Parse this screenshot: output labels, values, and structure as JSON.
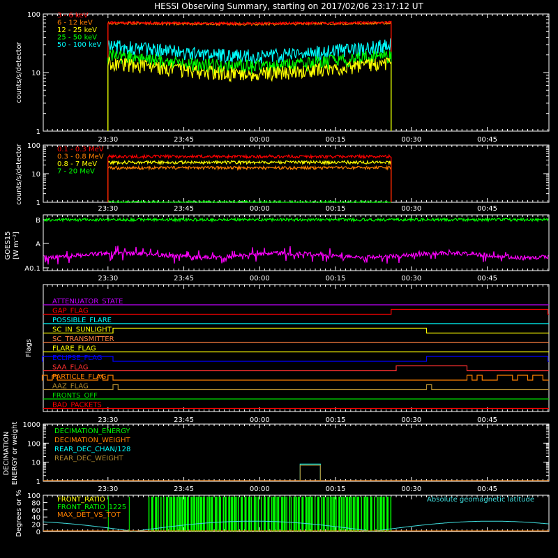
{
  "title": "HESSI Observing Summary, starting on 2017/02/06 23:17:12 UT",
  "time_axis": {
    "start": "23:17:12",
    "end": "00:57:12",
    "tick_labels": [
      "23:30",
      "23:45",
      "00:00",
      "00:15",
      "00:30",
      "00:45"
    ]
  },
  "chart_data": [
    {
      "type": "line",
      "id": "low_energy",
      "ylabel": "counts/s/detector",
      "yscale": "log",
      "ylim": [
        1,
        100
      ],
      "ytick_labels": [
        "1",
        "10",
        "100"
      ],
      "data_interval": [
        "23:30",
        "00:26"
      ],
      "series": [
        {
          "name": "3 - 6 keV",
          "color": "#ff0000",
          "level": 72
        },
        {
          "name": "6 - 12 keV",
          "color": "#ff7f00",
          "level": 70
        },
        {
          "name": "12 - 25 keV",
          "color": "#ffff00",
          "level": 15
        },
        {
          "name": "25 - 50 keV",
          "color": "#00ff00",
          "level": 20
        },
        {
          "name": "50 - 100 keV",
          "color": "#00ffff",
          "level": 30
        }
      ]
    },
    {
      "type": "line",
      "id": "high_energy",
      "ylabel": "counts/s/detector",
      "yscale": "log",
      "ylim": [
        1,
        100
      ],
      "ytick_labels": [
        "1",
        "10",
        "100"
      ],
      "data_interval": [
        "23:30",
        "00:26"
      ],
      "series": [
        {
          "name": "0.1 - 0.3 MeV",
          "color": "#ff0000",
          "level": 40
        },
        {
          "name": "0.3 - 0.8 MeV",
          "color": "#ff7f00",
          "level": 16
        },
        {
          "name": "0.8 - 7 MeV",
          "color": "#ffff00",
          "level": 25
        },
        {
          "name": "7 - 20 MeV",
          "color": "#00ff00",
          "level": 1
        }
      ]
    },
    {
      "type": "line",
      "id": "goes",
      "ylabel": "GOES15",
      "ylabel2": "[W m⁻²]",
      "ytick_labels": [
        "A0.1",
        "A",
        "B"
      ],
      "series": [
        {
          "name": "long",
          "color": "#00ff00",
          "level": "B"
        },
        {
          "name": "short",
          "color": "#ff00ff",
          "level": "A0.3"
        }
      ]
    },
    {
      "type": "line",
      "id": "flags",
      "ylabel": "Flags",
      "flags": [
        {
          "name": "ATTENUATOR_STATE",
          "color": "#c000ff",
          "segments": []
        },
        {
          "name": "GAP_FLAG",
          "color": "#ff0000",
          "segments": [
            [
              "00:26",
              "00:57"
            ]
          ]
        },
        {
          "name": "POSSIBLE_FLARE",
          "color": "#00ffff",
          "segments": []
        },
        {
          "name": "SC_IN_SUNLIGHT",
          "color": "#ffff00",
          "segments": [
            [
              "23:31",
              "00:33"
            ]
          ]
        },
        {
          "name": "SC_TRANSMITTER",
          "color": "#ff8040",
          "segments": []
        },
        {
          "name": "FLARE_FLAG",
          "color": "#ffff00",
          "segments": []
        },
        {
          "name": "ECLIPSE_FLAG",
          "color": "#0000ff",
          "segments": [
            [
              "23:17",
              "23:31"
            ],
            [
              "00:33",
              "00:57"
            ]
          ]
        },
        {
          "name": "SAA_FLAG",
          "color": "#ff3030",
          "segments": [
            [
              "00:27",
              "00:41"
            ]
          ]
        },
        {
          "name": "PARTICLE_FLAG",
          "color": "#ff8000",
          "segments": [
            [
              "23:17",
              "23:18"
            ],
            [
              "23:19",
              "23:20"
            ],
            [
              "23:28",
              "23:29"
            ],
            [
              "23:30",
              "23:31"
            ],
            [
              "00:41",
              "00:42"
            ],
            [
              "00:43",
              "00:44"
            ],
            [
              "00:47",
              "00:50"
            ],
            [
              "00:51",
              "00:53"
            ],
            [
              "00:54",
              "00:56"
            ]
          ]
        },
        {
          "name": "AAZ_FLAG",
          "color": "#b08a30",
          "segments": [
            [
              "23:31",
              "23:32"
            ],
            [
              "00:33",
              "00:34"
            ]
          ]
        },
        {
          "name": "FRONTS_OFF",
          "color": "#00e000",
          "segments": []
        },
        {
          "name": "BAD_PACKETS",
          "color": "#ff0000",
          "segments": []
        }
      ]
    },
    {
      "type": "line",
      "id": "decimation",
      "ylabel": "DECIMATION",
      "ylabel2": "ENERGY or weight",
      "yscale": "log",
      "ylim": [
        1,
        1000
      ],
      "ytick_labels": [
        "1",
        "10",
        "100",
        "1000"
      ],
      "series": [
        {
          "name": "DECIMATION_ENERGY",
          "color": "#00ff00"
        },
        {
          "name": "DECIMATION_WEIGHT",
          "color": "#ff8000"
        },
        {
          "name": "REAR_DEC_CHAN/128",
          "color": "#00ffff",
          "interval": [
            "00:08",
            "00:12"
          ],
          "level": 8
        },
        {
          "name": "REAR_DEC_WEIGHT",
          "color": "#b08a30",
          "interval": [
            "00:08",
            "00:12"
          ],
          "level": 7
        }
      ]
    },
    {
      "type": "line",
      "id": "ratio",
      "ylabel": "Degrees or %",
      "ylim": [
        0,
        100
      ],
      "ytick_labels": [
        "0",
        "20",
        "40",
        "60",
        "80",
        "100"
      ],
      "annotation": "Absolute geomagnetic latitude",
      "series": [
        {
          "name": "FRONT_RATIO",
          "color": "#ffff00"
        },
        {
          "name": "FRONT_RATIO_1225",
          "color": "#00ff00"
        },
        {
          "name": "MAX_DET_VS_TOT",
          "color": "#ff8000"
        },
        {
          "name": "Absolute geomagnetic latitude",
          "color": "#40e0e0"
        }
      ]
    }
  ]
}
